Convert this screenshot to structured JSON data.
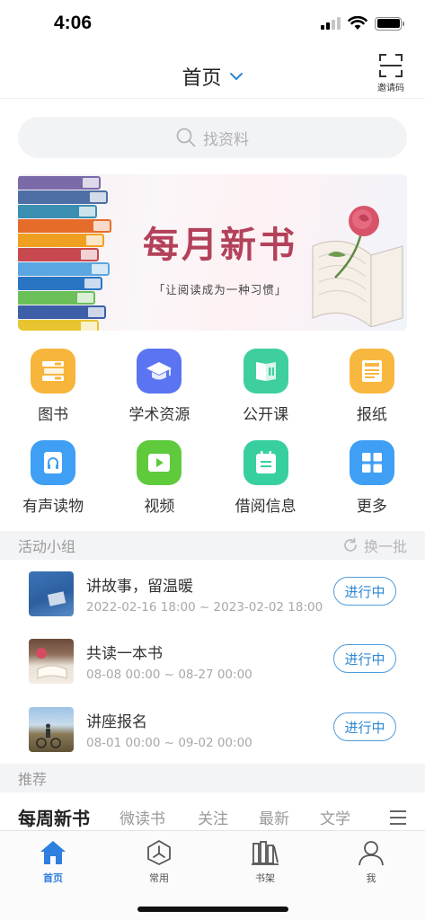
{
  "status_bar": {
    "time": "4:06"
  },
  "nav": {
    "title": "首页",
    "scan_label": "邀请码"
  },
  "search": {
    "placeholder": "找资料"
  },
  "banner": {
    "title": "每月新书",
    "subtitle": "「让阅读成为一种习惯」"
  },
  "functions": [
    {
      "label": "图书",
      "icon": "books-icon",
      "color": "#f7b53c"
    },
    {
      "label": "学术资源",
      "icon": "graduation-cap-icon",
      "color": "#5b74f1"
    },
    {
      "label": "公开课",
      "icon": "open-course-icon",
      "color": "#3fcf9f"
    },
    {
      "label": "报纸",
      "icon": "newspaper-icon",
      "color": "#f8b840"
    },
    {
      "label": "有声读物",
      "icon": "audiobook-icon",
      "color": "#3f9ff5"
    },
    {
      "label": "视频",
      "icon": "video-icon",
      "color": "#5fca3c"
    },
    {
      "label": "借阅信息",
      "icon": "calendar-icon",
      "color": "#38cfa0"
    },
    {
      "label": "更多",
      "icon": "grid-more-icon",
      "color": "#3f9ff5"
    }
  ],
  "activity_section": {
    "title": "活动小组",
    "refresh_label": "换一批"
  },
  "activities": [
    {
      "title": "讲故事，留温暖",
      "time": "2022-02-16 18:00 ~ 2023-02-02 18:00",
      "status": "进行中"
    },
    {
      "title": "共读一本书",
      "time": "08-08 00:00 ~ 08-27 00:00",
      "status": "进行中"
    },
    {
      "title": "讲座报名",
      "time": "08-01 00:00 ~ 09-02 00:00",
      "status": "进行中"
    }
  ],
  "recommend_section": {
    "title": "推荐"
  },
  "categories": [
    "每周新书",
    "微读书",
    "关注",
    "最新",
    "文学"
  ],
  "tab_bar": [
    {
      "label": "首页",
      "icon": "home-icon"
    },
    {
      "label": "常用",
      "icon": "compass-icon"
    },
    {
      "label": "书架",
      "icon": "bookshelf-icon"
    },
    {
      "label": "我",
      "icon": "user-icon"
    }
  ],
  "colors": {
    "accent": "#2f7fe0",
    "status_border": "#4f9cdb",
    "banner_title": "#b3415a"
  }
}
